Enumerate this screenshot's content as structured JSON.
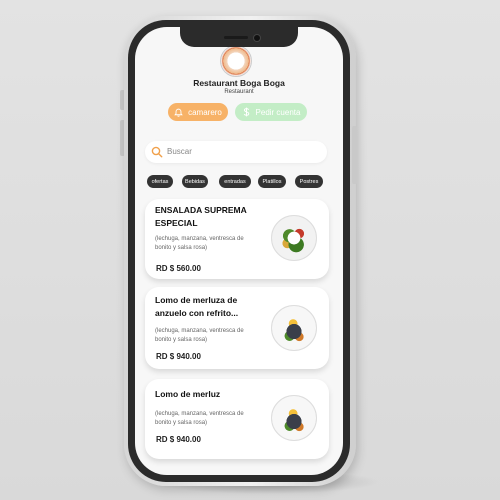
{
  "restaurant": {
    "name": "Restaurant Boga Boga",
    "type": "Restaurant"
  },
  "actions": {
    "waiter_label": "camarero",
    "bill_label": "Pedir cuenta"
  },
  "search": {
    "placeholder": "Buscar"
  },
  "categories": [
    "ofertas",
    "Bebidas",
    "entradas",
    "Platillos",
    "Postres"
  ],
  "menu_items": [
    {
      "title": "ENSALADA SUPREMA ESPECIAL",
      "description": "(lechuga, manzana, ventresca de bonito y salsa rosa)",
      "price": "RD $ 560.00",
      "image": "salad-image"
    },
    {
      "title": "Lomo de merluza de anzuelo con refrito...",
      "description": "(lechuga, manzana, ventresca de bonito y salsa rosa)",
      "price": "RD $ 940.00",
      "image": "fish-image"
    },
    {
      "title": "Lomo de merluz",
      "description": "(lechuga, manzana, ventresca de bonito y salsa rosa)",
      "price": "RD $ 940.00",
      "image": "fish-image"
    }
  ],
  "colors": {
    "waiter_button": "#f7b267",
    "bill_button": "#c3edc6",
    "search_icon": "#f0a04b",
    "chip": "#333333"
  }
}
